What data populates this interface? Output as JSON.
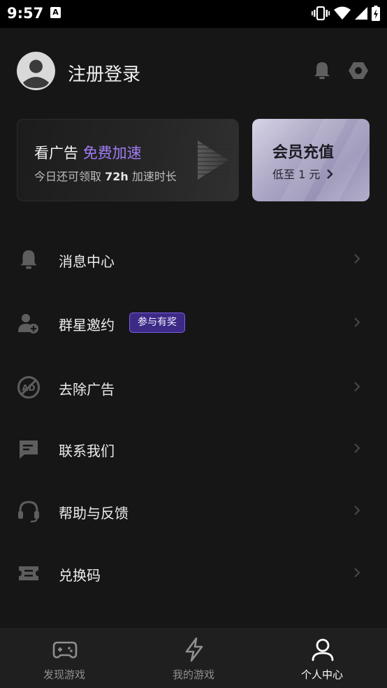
{
  "status_bar": {
    "time": "9:57",
    "notification_icon": "A",
    "icons": [
      "vibrate-icon",
      "wifi-icon",
      "signal-icon",
      "battery-icon"
    ]
  },
  "header": {
    "login_text": "注册登录",
    "icons": [
      "bell-icon",
      "settings-icon"
    ]
  },
  "ad_card": {
    "title": "看广告",
    "title_highlight": "免费加速",
    "sub_prefix": "今日还可领取",
    "sub_hours": "72h",
    "sub_suffix": "加速时长"
  },
  "vip_card": {
    "title": "会员充值",
    "subtitle": "低至 1 元"
  },
  "menu": [
    {
      "label": "消息中心",
      "icon": "bell-icon"
    },
    {
      "label": "群星邀约",
      "icon": "add-user-icon",
      "badge": "参与有奖"
    },
    {
      "label": "去除广告",
      "icon": "no-ads-icon"
    },
    {
      "label": "联系我们",
      "icon": "chat-icon"
    },
    {
      "label": "帮助与反馈",
      "icon": "headset-icon"
    },
    {
      "label": "兑换码",
      "icon": "ticket-icon"
    }
  ],
  "bottom_nav": [
    {
      "label": "发现游戏",
      "icon": "gamepad-icon",
      "active": false
    },
    {
      "label": "我的游戏",
      "icon": "lightning-icon",
      "active": false
    },
    {
      "label": "个人中心",
      "icon": "person-icon",
      "active": true
    }
  ],
  "colors": {
    "background": "#161616",
    "accent": "#a07cf7",
    "badge_bg": "#3d2a86",
    "vip_card": "#a8a4c2"
  }
}
